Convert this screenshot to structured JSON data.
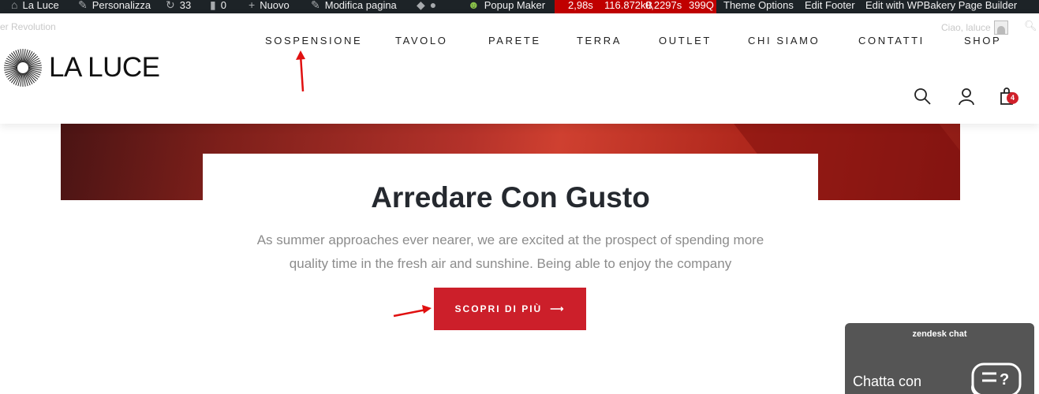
{
  "adminbar": {
    "site_name": "La Luce",
    "customize": "Personalizza",
    "updates_count": "33",
    "comments_count": "0",
    "new": "Nuovo",
    "edit_page": "Modifica pagina",
    "popup_maker": "Popup Maker",
    "perf_time": "2,98s",
    "perf_mem": "116.872kB",
    "perf_query_time": "0,2297s",
    "perf_queries": "399Q",
    "theme_options": "Theme Options",
    "edit_footer": "Edit Footer",
    "wpbakery": "Edit with WPBakery Page Builder",
    "bg": "#1d2327",
    "perf_bg": "#c00000"
  },
  "header": {
    "rev_text": "er Revolution",
    "greeting": "Ciao, laluce",
    "logo_text": "LA LUCE",
    "nav": [
      "SOSPENSIONE",
      "TAVOLO",
      "PARETE",
      "TERRA",
      "OUTLET",
      "CHI SIAMO",
      "CONTATTI",
      "SHOP"
    ],
    "cart_count": "4"
  },
  "hero": {
    "title": "Arredare Con Gusto",
    "subtitle_line1": "As summer approaches ever nearer, we are excited at the prospect of spending more",
    "subtitle_line2": "quality time in the fresh air and sunshine. Being able to enjoy the company",
    "cta_label": "SCOPRI DI PIÙ",
    "cta_arrow": "⟶",
    "accent": "#cc1f2a"
  },
  "zendesk": {
    "title": "zendesk chat",
    "text": "Chatta con",
    "bg": "#555555"
  }
}
